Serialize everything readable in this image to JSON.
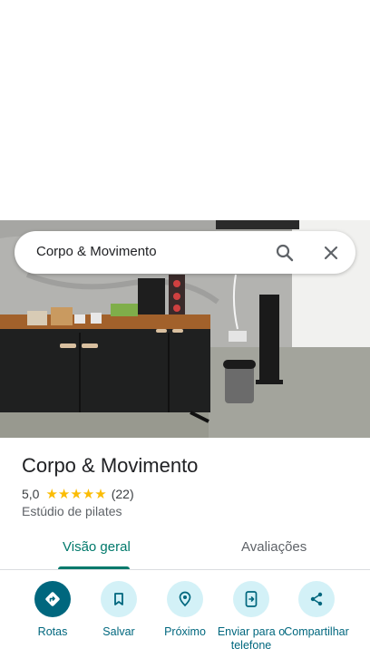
{
  "search": {
    "query": "Corpo & Movimento"
  },
  "place": {
    "name": "Corpo & Movimento",
    "rating": "5,0",
    "stars": "★★★★★",
    "review_count": "(22)",
    "category": "Estúdio de pilates"
  },
  "tabs": [
    {
      "label": "Visão geral",
      "active": true
    },
    {
      "label": "Avaliações",
      "active": false
    }
  ],
  "actions": [
    {
      "label": "Rotas",
      "icon": "directions-icon"
    },
    {
      "label": "Salvar",
      "icon": "bookmark-icon"
    },
    {
      "label": "Próximo",
      "icon": "nearby-icon"
    },
    {
      "label": "Enviar para o telefone",
      "icon": "send-to-phone-icon"
    },
    {
      "label": "Compartilhar",
      "icon": "share-icon"
    }
  ],
  "colors": {
    "accent": "#00796b",
    "action_bg": "#d3f1f7",
    "action_primary": "#00677e",
    "star": "#fbbc04"
  }
}
